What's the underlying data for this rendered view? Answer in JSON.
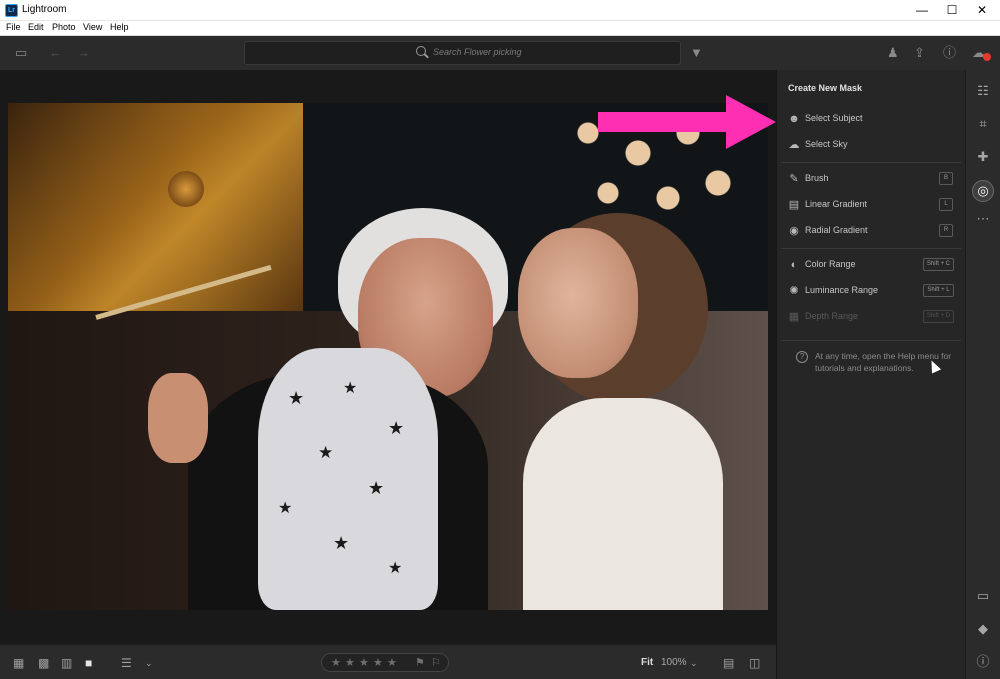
{
  "window": {
    "title": "Lightroom",
    "logo_text": "Lr",
    "minimize": "—",
    "maximize": "☐",
    "close": "✕"
  },
  "menu": [
    "File",
    "Edit",
    "Photo",
    "View",
    "Help"
  ],
  "toolbar": {
    "search_placeholder": "Search Flower picking"
  },
  "mask_panel": {
    "title": "Create New Mask",
    "items": [
      {
        "label": "Select Subject",
        "icon": "subject-icon",
        "shortcut": "",
        "disabled": false
      },
      {
        "label": "Select Sky",
        "icon": "sky-icon",
        "shortcut": "",
        "disabled": false
      },
      {
        "label": "Brush",
        "icon": "brush-icon",
        "shortcut": "B",
        "disabled": false
      },
      {
        "label": "Linear Gradient",
        "icon": "linear-gradient-icon",
        "shortcut": "L",
        "disabled": false
      },
      {
        "label": "Radial Gradient",
        "icon": "radial-gradient-icon",
        "shortcut": "R",
        "disabled": false
      },
      {
        "label": "Color Range",
        "icon": "color-range-icon",
        "shortcut": "Shift + C",
        "disabled": false
      },
      {
        "label": "Luminance Range",
        "icon": "luminance-range-icon",
        "shortcut": "Shift + L",
        "disabled": false
      },
      {
        "label": "Depth Range",
        "icon": "depth-range-icon",
        "shortcut": "Shift + D",
        "disabled": true
      }
    ],
    "help_text": "At any time, open the Help menu for tutorials and explanations."
  },
  "bottom_bar": {
    "fit_label": "Fit",
    "zoom_level": "100%",
    "stars": [
      "★",
      "★",
      "★",
      "★",
      "★"
    ]
  },
  "colors": {
    "arrow": "#ff2fb3",
    "panel_bg": "#262626",
    "toolbar_bg": "#2b2b2b",
    "notification_badge": "#e43a2f"
  }
}
